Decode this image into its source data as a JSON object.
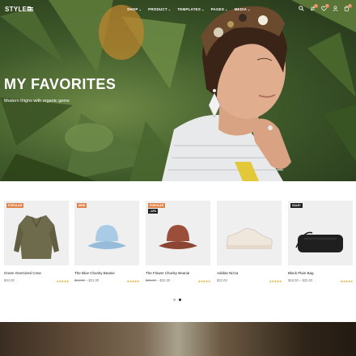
{
  "header": {
    "logo": "STYLER",
    "nav": [
      "SHOP",
      "PRODUCT",
      "TEMPLATES",
      "PAGES",
      "MEDIA"
    ],
    "badges": {
      "compare": "0",
      "wishlist": "0",
      "cart": "0"
    }
  },
  "hero": {
    "title": "MY FAVORITES",
    "subtitle": "Modern thigns with organic gems"
  },
  "products": [
    {
      "tag": "POPULAR",
      "name": "Green Oversized Crew",
      "price": "$34.00",
      "stars": "★★★★★"
    },
    {
      "tag": "NEW",
      "name": "The Blue Chunky Beanie",
      "old_price": "$24.00",
      "separator": "–",
      "price": "$21.00",
      "stars": "★★★★★"
    },
    {
      "tag": "POPULAR",
      "discount": "-12%",
      "name": "The Flower Chunky Beanie",
      "old_price": "$25.00",
      "separator": "–",
      "price": "$22.00",
      "stars": "★★★★★"
    },
    {
      "name": "Adidas Nizza",
      "price": "$22.00",
      "stars": "★★★★★"
    },
    {
      "tag": "SALE!",
      "name": "Black Plain Bag",
      "min_price": "$18.00",
      "separator": "–",
      "max_price": "$20.00",
      "stars": "★★★★★"
    }
  ],
  "colors": {
    "accent": "#e0844d",
    "rating": "#d9a822",
    "text": "#222222"
  }
}
